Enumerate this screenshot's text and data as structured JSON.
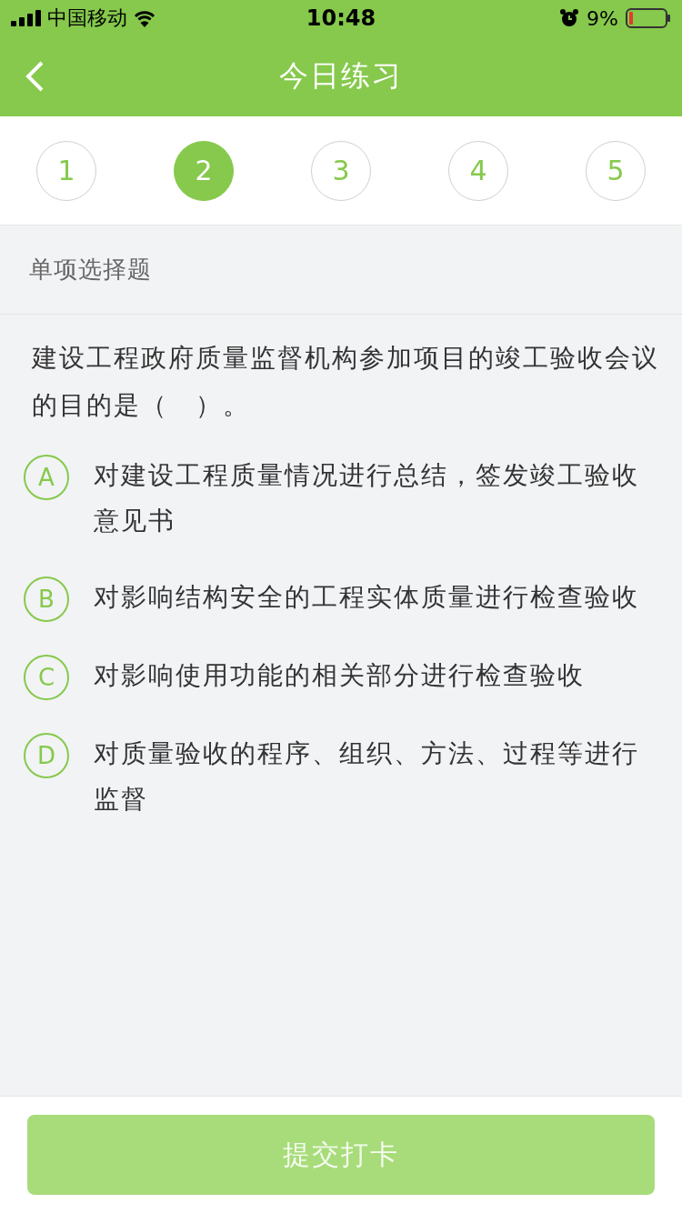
{
  "status_bar": {
    "carrier": "中国移动",
    "time": "10:48",
    "battery": "9%"
  },
  "nav": {
    "title": "今日练习"
  },
  "question_tabs": [
    {
      "label": "1",
      "selected": false
    },
    {
      "label": "2",
      "selected": true
    },
    {
      "label": "3",
      "selected": false
    },
    {
      "label": "4",
      "selected": false
    },
    {
      "label": "5",
      "selected": false
    }
  ],
  "section": "单项选择题",
  "question": "建设工程政府质量监督机构参加项目的竣工验收会议的目的是（　）。",
  "options": [
    {
      "letter": "A",
      "text": "对建设工程质量情况进行总结，签发竣工验收意见书",
      "selected": false
    },
    {
      "letter": "B",
      "text": "对影响结构安全的工程实体质量进行检查验收",
      "selected": false
    },
    {
      "letter": "C",
      "text": "对影响使用功能的相关部分进行检查验收",
      "selected": false
    },
    {
      "letter": "D",
      "text": "对质量验收的程序、组织、方法、过程等进行监督",
      "selected": false
    }
  ],
  "submit": {
    "label": "提交打卡",
    "disabled": true
  }
}
